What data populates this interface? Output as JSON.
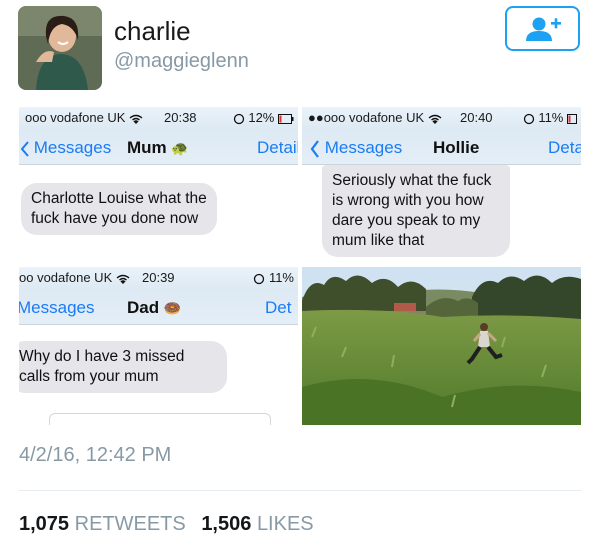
{
  "profile": {
    "display_name": "charlie",
    "handle": "@maggieglenn"
  },
  "follow_button": {
    "icon": "add-user-icon",
    "color": "#1da1f2"
  },
  "screens": [
    {
      "carrier": "ooo vodafone UK",
      "time": "20:38",
      "battery": "12%",
      "back_label": "Messages",
      "contact": "Mum",
      "contact_emoji": "🐢",
      "detail_label": "Detail",
      "message": "Charlotte Louise what the fuck have you done now"
    },
    {
      "carrier": "●●ooo vodafone UK",
      "time": "20:40",
      "battery": "11%",
      "back_label": "Messages",
      "contact": "Hollie",
      "detail_label": "Deta",
      "message": "Seriously what the fuck is wrong with you how dare you speak to my mum like that"
    },
    {
      "carrier": "oo vodafone UK",
      "time": "20:39",
      "battery": "11%",
      "back_label": "Messages",
      "contact": "Dad",
      "contact_emoji": "🍩",
      "detail_label": "Det",
      "message": "Why do I have 3 missed calls from your mum"
    }
  ],
  "tweet": {
    "timestamp": "4/2/16, 12:42 PM",
    "retweets_count": "1,075",
    "retweets_label": "RETWEETS",
    "likes_count": "1,506",
    "likes_label": "LIKES"
  },
  "colors": {
    "ios_blue": "#1a7cf5",
    "bubble_gray": "#e5e5ea",
    "muted_text": "#8899a6"
  }
}
